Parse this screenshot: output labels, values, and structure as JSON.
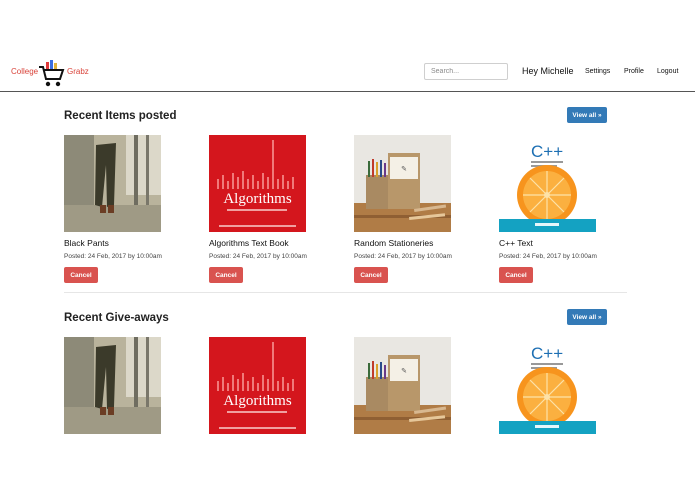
{
  "brand": {
    "left": "College",
    "right": "Grabz",
    "accent_color": "#d9433a"
  },
  "nav": {
    "search_placeholder": "Search...",
    "greeting": "Hey Michelle",
    "settings": "Settings",
    "profile": "Profile",
    "logout": "Logout"
  },
  "sections": [
    {
      "title": "Recent Items posted",
      "view_all": "View all »",
      "items": [
        {
          "name": "Black Pants",
          "posted": "Posted: 24 Feb, 2017 by 10:00am",
          "action": "Cancel"
        },
        {
          "name": "Algorithms Text Book",
          "posted": "Posted: 24 Feb, 2017 by 10:00am",
          "action": "Cancel"
        },
        {
          "name": "Random Stationeries",
          "posted": "Posted: 24 Feb, 2017 by 10:00am",
          "action": "Cancel"
        },
        {
          "name": "C++ Text",
          "posted": "Posted: 24 Feb, 2017 by 10:00am",
          "action": "Cancel"
        }
      ]
    },
    {
      "title": "Recent Give-aways",
      "view_all": "View all »"
    }
  ],
  "book_covers": {
    "algorithms_title": "Algorithms",
    "cpp_title": "C++"
  },
  "colors": {
    "primary": "#337ab7",
    "danger": "#d9534f"
  }
}
